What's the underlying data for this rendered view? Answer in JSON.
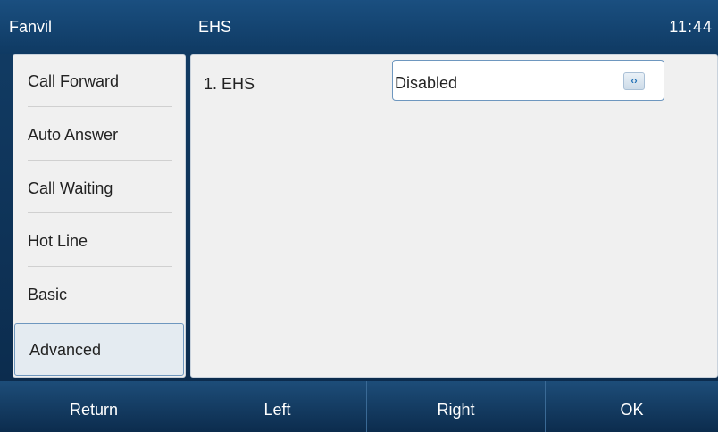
{
  "statusbar": {
    "brand": "Fanvil",
    "title": "EHS",
    "clock": "11:44"
  },
  "sidemenu": {
    "items": [
      {
        "label": "Call Forward"
      },
      {
        "label": "Auto Answer"
      },
      {
        "label": "Call Waiting"
      },
      {
        "label": "Hot Line"
      },
      {
        "label": "Basic"
      },
      {
        "label": "Advanced"
      }
    ],
    "active_index": 5
  },
  "content": {
    "settings": [
      {
        "label": "1. EHS",
        "value": "Disabled",
        "control_icon": "left-right-arrows-icon"
      }
    ]
  },
  "softkeys": [
    {
      "label": "Return"
    },
    {
      "label": "Left"
    },
    {
      "label": "Right"
    },
    {
      "label": "OK"
    }
  ],
  "colors": {
    "header_bg": "#1a4f80",
    "panel_bg": "#f0f0f0",
    "accent_border": "#6e97bf",
    "softkey_bg": "#1d4d79"
  }
}
